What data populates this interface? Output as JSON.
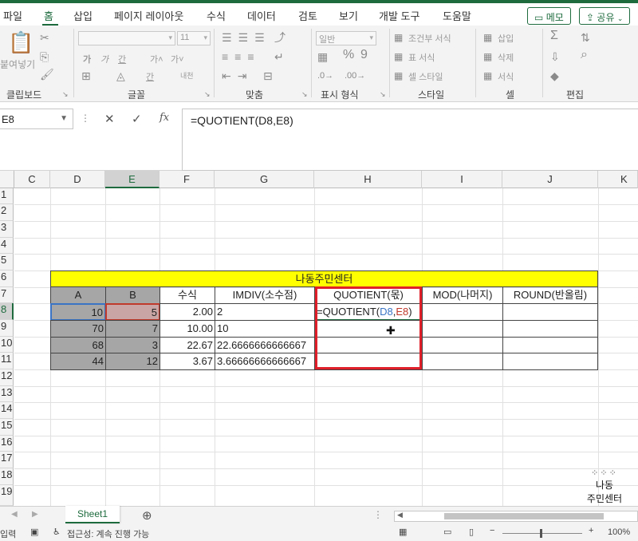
{
  "ribbon_tabs": [
    "파일",
    "홈",
    "삽입",
    "페이지 레이아웃",
    "수식",
    "데이터",
    "검토",
    "보기",
    "개발 도구",
    "도움말"
  ],
  "memo_button": "메모",
  "share_button": "공유",
  "ribbon": {
    "clipboard": {
      "paste_label": "붙여넣기",
      "group": "클립보드"
    },
    "font": {
      "size": "11",
      "bold": "가",
      "italic": "가",
      "underline": "간",
      "grow": "가˄",
      "shrink": "가˅",
      "phonetic": "내천",
      "group": "글꼴"
    },
    "alignment": {
      "group": "맞춤"
    },
    "number": {
      "format": "일반",
      "group": "표시 형식"
    },
    "styles": {
      "conditional": "조건부 서식",
      "table": "표 서식",
      "cell_style": "셀 스타일",
      "group": "스타일"
    },
    "cells": {
      "insert": "삽입",
      "delete": "삭제",
      "format": "서식",
      "group": "셀"
    },
    "editing": {
      "group": "편집"
    }
  },
  "formula_bar": {
    "name_box": "E8",
    "cancel": "✕",
    "enter": "✓",
    "fx": "fx",
    "formula": "=QUOTIENT(D8,E8)"
  },
  "columns": [
    "C",
    "D",
    "E",
    "F",
    "G",
    "H",
    "I",
    "J",
    "K"
  ],
  "rows": [
    "1",
    "2",
    "3",
    "4",
    "5",
    "6",
    "7",
    "8",
    "9",
    "10",
    "11",
    "12",
    "13",
    "14",
    "15",
    "16",
    "17",
    "18",
    "19"
  ],
  "table": {
    "title": "나동주민센터",
    "headers": [
      "A",
      "B",
      "수식",
      "IMDIV(소수점)",
      "QUOTIENT(몫)",
      "MOD(나머지)",
      "ROUND(반올림)"
    ],
    "rows": [
      {
        "a": "10",
        "b": "5",
        "formula": "2.00",
        "imdiv": "2"
      },
      {
        "a": "70",
        "b": "7",
        "formula": "10.00",
        "imdiv": "10"
      },
      {
        "a": "68",
        "b": "3",
        "formula": "22.67",
        "imdiv": "22.6666666666667"
      },
      {
        "a": "44",
        "b": "12",
        "formula": "3.67",
        "imdiv": "3.66666666666667"
      }
    ],
    "editing_prefix": "=QUOTIENT(",
    "editing_ref1": "D8",
    "editing_comma": ",",
    "editing_ref2": "E8",
    "editing_suffix": ")"
  },
  "watermark": {
    "line1": "나동",
    "line2": "주민센터"
  },
  "sheet_tab": "Sheet1",
  "status": {
    "mode": "입력",
    "accessibility": "접근성: 계속 진행 가능",
    "zoom": "100%"
  },
  "colors": {
    "accent": "#1e6b3e",
    "highlight_red": "#e0202a",
    "ref_blue": "#3a74c4",
    "ref_red": "#c0392b",
    "title_yellow": "#ffff00",
    "header_gray": "#a6a6a6"
  }
}
